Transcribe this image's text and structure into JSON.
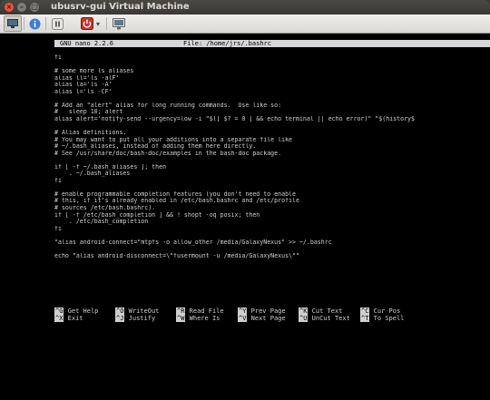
{
  "window": {
    "title": "ubusrv-gui Virtual Machine",
    "buttons": {
      "close": "×",
      "minimize": "–",
      "maximize": "□"
    }
  },
  "toolbar": {
    "items": [
      {
        "name": "display-icon",
        "glyph": "▭"
      },
      {
        "name": "info-icon",
        "glyph": "i"
      },
      {
        "name": "pause-icon",
        "glyph": "❚❚"
      },
      {
        "name": "power-icon",
        "glyph": "⏻"
      },
      {
        "name": "dropdown-icon",
        "glyph": "▾"
      },
      {
        "name": "snapshot-icon",
        "glyph": "▣"
      }
    ]
  },
  "nano": {
    "header_left": "GNU nano 2.2.6",
    "header_center": "File: /home/jrs/.bashrc",
    "lines": [
      "fi",
      "",
      "# some more ls aliases",
      "alias ll='ls -alF'",
      "alias la='ls -A'",
      "alias l='ls -CF'",
      "",
      "# Add an \"alert\" alias for long running commands.  Use like so:",
      "#   sleep 10; alert",
      "alias alert='notify-send --urgency=low -i \"$([ $? = 0 ] && echo terminal || echo error)\" \"$(history$",
      "",
      "# Alias definitions.",
      "# You may want to put all your additions into a separate file like",
      "# ~/.bash_aliases, instead of adding them here directly.",
      "# See /usr/share/doc/bash-doc/examples in the bash-doc package.",
      "",
      "if [ -f ~/.bash_aliases ]; then",
      "    . ~/.bash_aliases",
      "fi",
      "",
      "# enable programmable completion features (you don't need to enable",
      "# this, if it's already enabled in /etc/bash.bashrc and /etc/profile",
      "# sources /etc/bash.bashrc).",
      "if [ -f /etc/bash_completion ] && ! shopt -oq posix; then",
      "    . /etc/bash_completion",
      "fi",
      "",
      "\"alias android-connect=\"mtpfs -o allow_other /media/GalaxyNexus\" >> ~/.bashrc",
      "",
      "echo \"alias android-disconnect=\\\"fusermount -u /media/GalaxyNexus\\\"\""
    ],
    "shortcuts_row1": [
      {
        "key": "^G",
        "label": "Get Help"
      },
      {
        "key": "^O",
        "label": "WriteOut"
      },
      {
        "key": "^R",
        "label": "Read File"
      },
      {
        "key": "^Y",
        "label": "Prev Page"
      },
      {
        "key": "^K",
        "label": "Cut Text"
      },
      {
        "key": "^C",
        "label": "Cur Pos"
      }
    ],
    "shortcuts_row2": [
      {
        "key": "^X",
        "label": "Exit"
      },
      {
        "key": "^J",
        "label": "Justify"
      },
      {
        "key": "^W",
        "label": "Where Is"
      },
      {
        "key": "^V",
        "label": "Next Page"
      },
      {
        "key": "^U",
        "label": "UnCut Text"
      },
      {
        "key": "^T",
        "label": "To Spell"
      }
    ]
  }
}
